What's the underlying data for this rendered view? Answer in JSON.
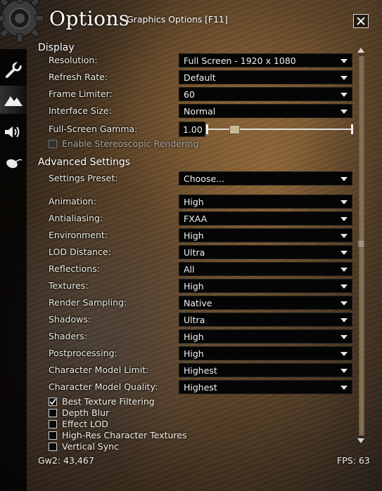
{
  "window": {
    "title": "Options",
    "subtitle": "Graphics Options",
    "hotkey": "[F11]"
  },
  "sidebar": {
    "tabs": [
      {
        "name": "general",
        "icon": "wrench-icon"
      },
      {
        "name": "graphics",
        "icon": "mountains-icon",
        "active": true
      },
      {
        "name": "sound",
        "icon": "speaker-icon"
      },
      {
        "name": "control",
        "icon": "mouse-icon"
      }
    ]
  },
  "display": {
    "heading": "Display",
    "resolution": {
      "label": "Resolution:",
      "value": "Full Screen - 1920 x 1080"
    },
    "refresh_rate": {
      "label": "Refresh Rate:",
      "value": "Default"
    },
    "frame_limiter": {
      "label": "Frame Limiter:",
      "value": "60"
    },
    "interface_size": {
      "label": "Interface Size:",
      "value": "Normal"
    },
    "gamma": {
      "label": "Full-Screen Gamma:",
      "value": "1.00",
      "slider_fraction": 0.17
    },
    "stereoscopic": {
      "label": "Enable Stereoscopic Rendering",
      "checked": false,
      "disabled": true
    }
  },
  "advanced": {
    "heading": "Advanced Settings",
    "preset": {
      "label": "Settings Preset:",
      "value": "Choose..."
    },
    "animation": {
      "label": "Animation:",
      "value": "High"
    },
    "antialiasing": {
      "label": "Antialiasing:",
      "value": "FXAA"
    },
    "environment": {
      "label": "Environment:",
      "value": "High"
    },
    "lod_distance": {
      "label": "LOD Distance:",
      "value": "Ultra"
    },
    "reflections": {
      "label": "Reflections:",
      "value": "All"
    },
    "textures": {
      "label": "Textures:",
      "value": "High"
    },
    "render_sampling": {
      "label": "Render Sampling:",
      "value": "Native"
    },
    "shadows": {
      "label": "Shadows:",
      "value": "Ultra"
    },
    "shaders": {
      "label": "Shaders:",
      "value": "High"
    },
    "postprocessing": {
      "label": "Postprocessing:",
      "value": "High"
    },
    "char_model_limit": {
      "label": "Character Model Limit:",
      "value": "Highest"
    },
    "char_model_quality": {
      "label": "Character Model Quality:",
      "value": "Highest"
    },
    "best_texture_filtering": {
      "label": "Best Texture Filtering",
      "checked": true
    },
    "depth_blur": {
      "label": "Depth Blur",
      "checked": false
    },
    "effect_lod": {
      "label": "Effect LOD",
      "checked": false
    },
    "high_res_textures": {
      "label": "High-Res Character Textures",
      "checked": false
    },
    "vertical_sync": {
      "label": "Vertical Sync",
      "checked": false
    }
  },
  "footer": {
    "left": "Gw2: 43,467",
    "right": "FPS: 63"
  }
}
